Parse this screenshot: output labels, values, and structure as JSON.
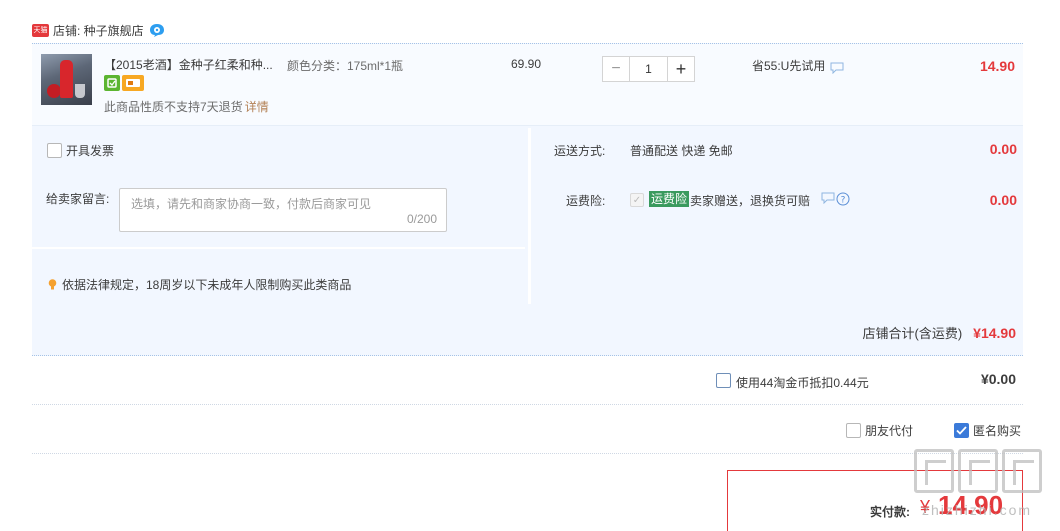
{
  "shop": {
    "label": "店铺: 种子旗舰店",
    "badge_text": "天猫",
    "brand_color": "#e4393c"
  },
  "item": {
    "title": "【2015老酒】金种子红柔和种...",
    "sku": "颜色分类：175ml*1瓶",
    "unit_price": "69.90",
    "quantity": "1",
    "qty_minus": "−",
    "qty_plus": "+",
    "discount": "省55:U先试用",
    "total": "14.90",
    "return_note": "此商品性质不支持7天退货",
    "detail_link": "详情"
  },
  "options": {
    "invoice_label": "开具发票",
    "message_label": "给卖家留言:",
    "message_placeholder": "选填，请先和商家协商一致，付款后商家可见",
    "message_counter": "0/200",
    "law_note": "依据法律规定，18周岁以下未成年人限制购买此类商品"
  },
  "shipping": {
    "label": "运送方式:",
    "value": "普通配送 快递 免邮",
    "fee": "0.00",
    "insurance_label": "运费险:",
    "insurance_badge": "运费险",
    "insurance_text": "卖家赠送，退换货可赔",
    "insurance_fee": "0.00"
  },
  "subtotal": {
    "label": "店铺合计(含运费)",
    "amount": "¥14.90"
  },
  "coins": {
    "label": "使用44淘金币抵扣0.44元",
    "amount": "¥0.00",
    "checked": false
  },
  "payment": {
    "friend_label": "朋友代付",
    "anonymous_label": "匿名购买",
    "anonymous_checked": true,
    "actual_label": "实付款:",
    "currency": "¥",
    "amount": "14.90"
  },
  "watermark": {
    "text": "zhizhizhi.com",
    "logo_icons": [
      "zhi-glyph-icon",
      "zhi-glyph-icon",
      "zhi-glyph-icon"
    ]
  }
}
